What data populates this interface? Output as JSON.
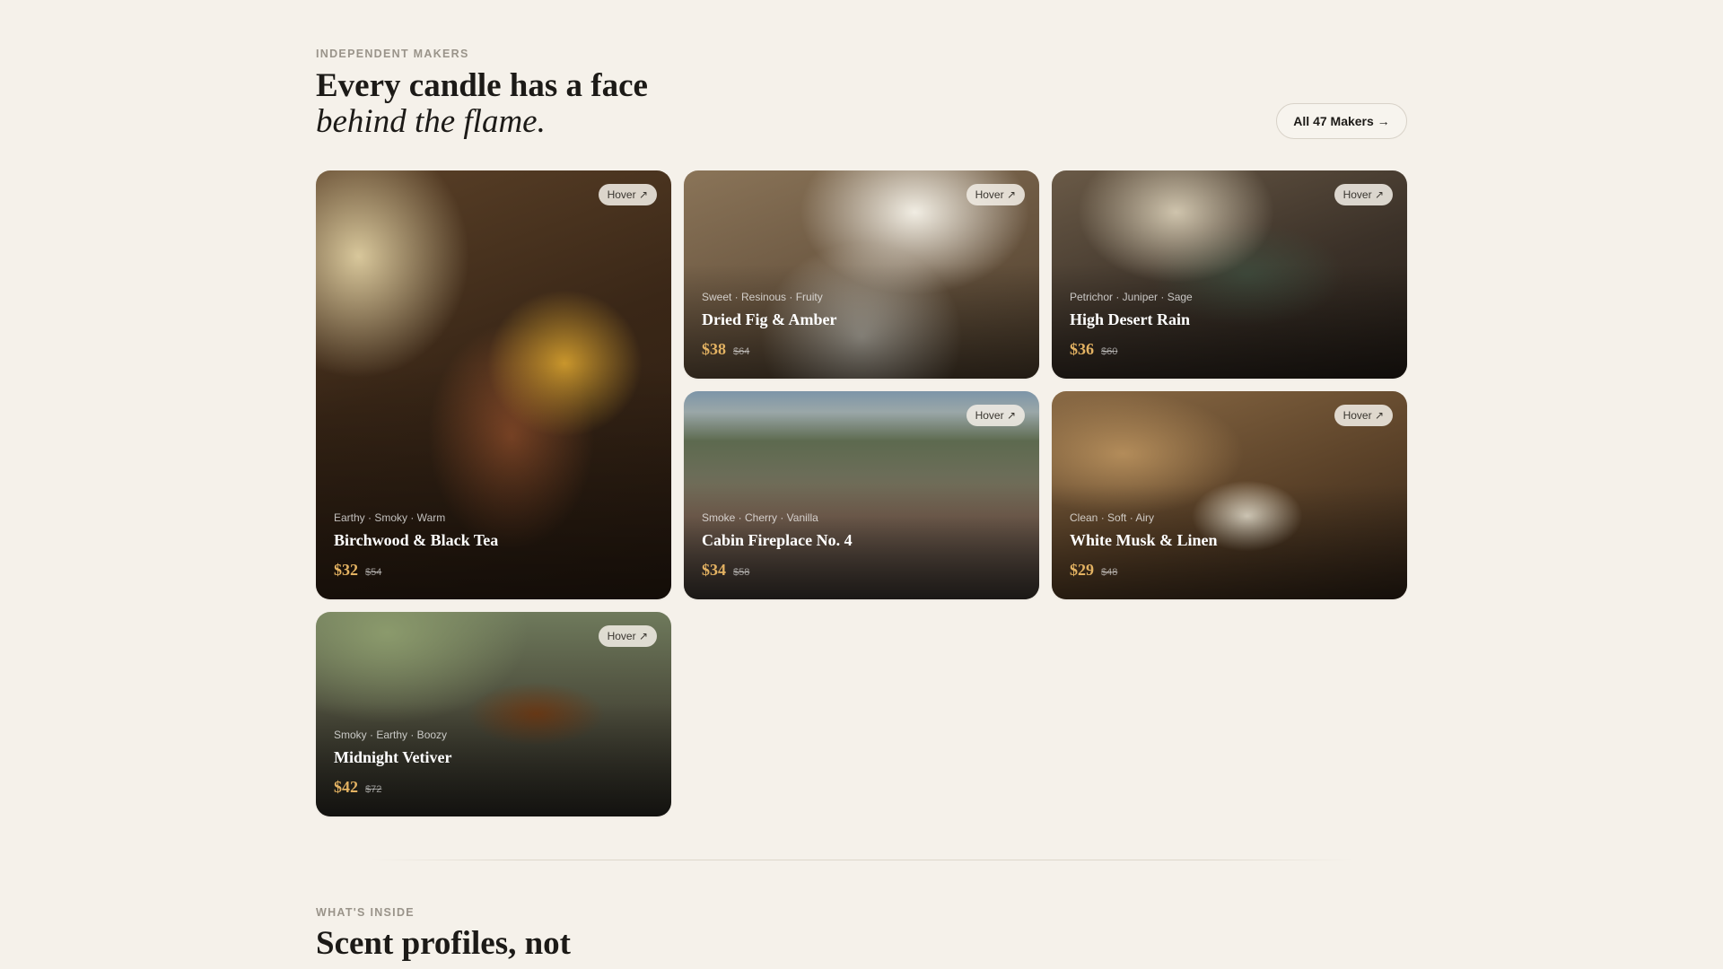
{
  "makers": {
    "eyebrow": "INDEPENDENT MAKERS",
    "title": "Every candle has a face",
    "title_italic": "behind the flame.",
    "all_button": "All 47 Makers →",
    "hover_label": "Hover ↗",
    "cards": [
      {
        "notes": "Earthy · Smoky · Warm",
        "name": "Birchwood & Black Tea",
        "price": "$32",
        "old_price": "$54",
        "hover": "Hover ↗"
      },
      {
        "notes": "Sweet · Resinous · Fruity",
        "name": "Dried Fig & Amber",
        "price": "$38",
        "old_price": "$64",
        "hover": "Hover ↗"
      },
      {
        "notes": "Petrichor · Juniper · Sage",
        "name": "High Desert Rain",
        "price": "$36",
        "old_price": "$60",
        "hover": "Hover ↗"
      },
      {
        "notes": "Smoke · Cherry · Vanilla",
        "name": "Cabin Fireplace No. 4",
        "price": "$34",
        "old_price": "$58",
        "hover": "Hover ↗"
      },
      {
        "notes": "Clean · Soft · Airy",
        "name": "White Musk & Linen",
        "price": "$29",
        "old_price": "$48",
        "hover": "Hover ↗"
      },
      {
        "notes": "Smoky · Earthy · Boozy",
        "name": "Midnight Vetiver",
        "price": "$42",
        "old_price": "$72",
        "hover": "Hover ↗"
      }
    ]
  },
  "inside": {
    "eyebrow": "WHAT'S INSIDE",
    "title": "Scent profiles, not"
  },
  "colors": {
    "background": "#f5f1ea",
    "price_accent": "#e3b262"
  }
}
